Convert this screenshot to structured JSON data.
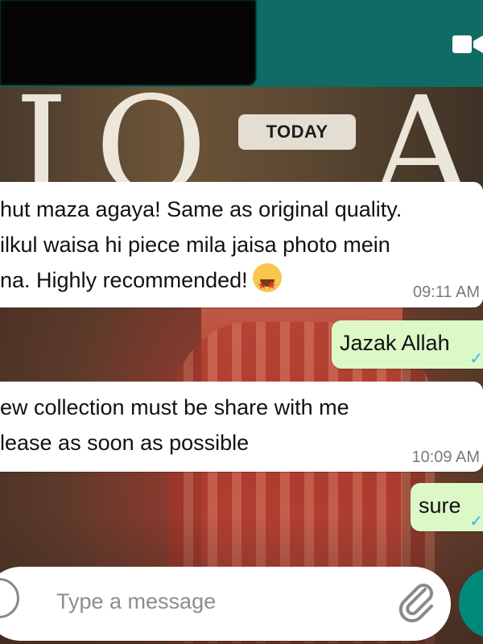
{
  "chat": {
    "date_label": "TODAY",
    "background_letters": [
      "I",
      "O",
      "A"
    ],
    "messages": [
      {
        "direction": "in",
        "lines": [
          "hut maza agaya! Same as original quality.",
          "ilkul waisa hi piece mila jaisa photo mein",
          "na. Highly recommended!"
        ],
        "emoji": "star-struck-emoji",
        "time": "09:11 AM"
      },
      {
        "direction": "out",
        "text": "Jazak Allah",
        "status": "delivered-tick"
      },
      {
        "direction": "in",
        "lines": [
          "ew collection must be share with me",
          "lease as soon as possible"
        ],
        "time": "10:09 AM"
      },
      {
        "direction": "out",
        "text": "sure",
        "status": "delivered-tick"
      }
    ]
  },
  "input": {
    "placeholder": "Type a message"
  },
  "icons": {
    "header_video": "video-call-icon",
    "emoji_button": "emoji-icon",
    "attach": "paperclip-icon",
    "send": "send-icon"
  },
  "colors": {
    "header": "#0f6b63",
    "outgoing_bubble": "#dcf8c6",
    "incoming_bubble": "#ffffff",
    "tick": "#34b7f1",
    "send_button": "#00897b"
  }
}
